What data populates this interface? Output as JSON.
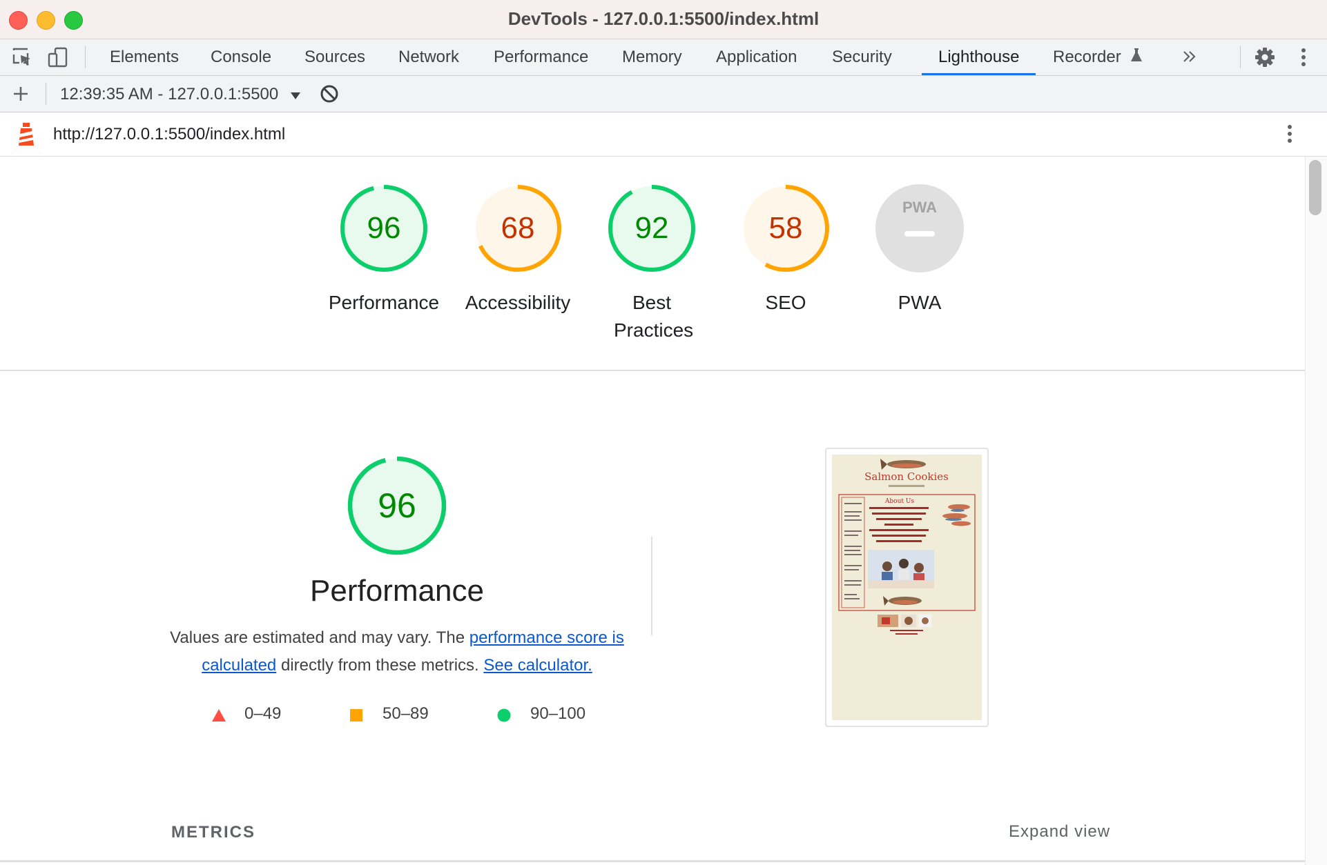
{
  "window": {
    "title": "DevTools - 127.0.0.1:5500/index.html"
  },
  "tabs": [
    {
      "label": "Elements"
    },
    {
      "label": "Console"
    },
    {
      "label": "Sources"
    },
    {
      "label": "Network"
    },
    {
      "label": "Performance"
    },
    {
      "label": "Memory"
    },
    {
      "label": "Application"
    },
    {
      "label": "Security"
    },
    {
      "label": "Lighthouse",
      "active": true
    },
    {
      "label": "Recorder"
    }
  ],
  "session": {
    "label": "12:39:35 AM - 127.0.0.1:5500"
  },
  "url": {
    "text": "http://127.0.0.1:5500/index.html"
  },
  "scores": [
    {
      "label": "Performance",
      "value": "96",
      "fraction": 0.96,
      "status": "pass"
    },
    {
      "label": "Accessibility",
      "value": "68",
      "fraction": 0.68,
      "status": "average"
    },
    {
      "label": "Best Practices",
      "value": "92",
      "fraction": 0.92,
      "status": "pass"
    },
    {
      "label": "SEO",
      "value": "58",
      "fraction": 0.58,
      "status": "average"
    },
    {
      "label": "PWA",
      "value": "PWA",
      "status": "na"
    }
  ],
  "performance": {
    "score": "96",
    "fraction": 0.96,
    "title": "Performance",
    "desc_prefix": "Values are estimated and may vary. The",
    "desc_link1": "performance score is calculated",
    "desc_middle": "directly from these metrics.",
    "desc_link2": "See calculator."
  },
  "legend": {
    "fail": "0–49",
    "average": "50–89",
    "pass": "90–100"
  },
  "thumbnail": {
    "site_title": "Salmon Cookies",
    "heading": "About Us",
    "body": "Founded in 2020 by Pat's love for sweets and passion for healthy, thriving ecosystems.Cookies are suitable for both humans and salmons to enjoy."
  },
  "metrics": {
    "title": "METRICS",
    "expand": "Expand view"
  },
  "colors": {
    "pass": "#0cce6b",
    "pass_text": "#008800",
    "pass_bg": "#e8f9ee",
    "average": "#ffa400",
    "average_text": "#c33300",
    "average_bg": "#fff6ea",
    "fail": "#ff4e42",
    "link": "#0b57d0",
    "accent": "#1a73e8"
  }
}
